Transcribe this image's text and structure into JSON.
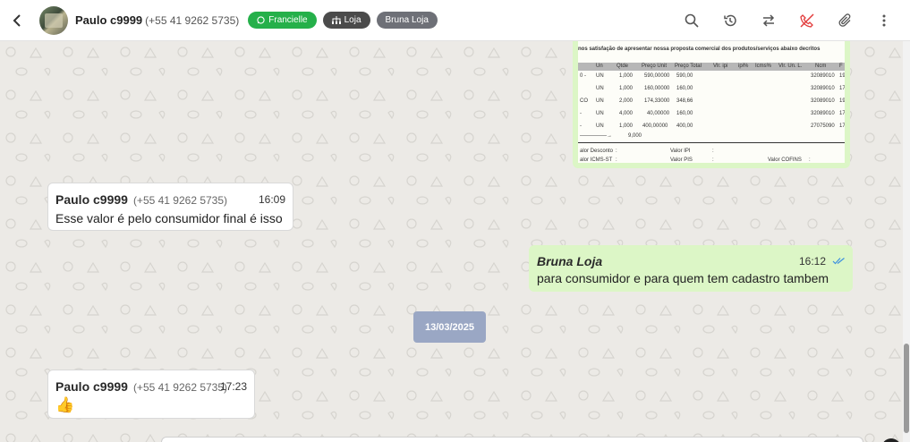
{
  "header": {
    "contact_name": "Paulo c9999",
    "contact_phone": "(+55 41 9262 5735)",
    "tags": [
      {
        "label": "Francielle",
        "color": "#25b04a",
        "icon": "whatsapp-icon"
      },
      {
        "label": "Loja",
        "color": "#4b4b4b",
        "icon": "sitemap-icon"
      },
      {
        "label": "Bruna Loja",
        "color": "#6e7077",
        "icon": ""
      }
    ],
    "actions": [
      "search-icon",
      "history-icon",
      "transfer-icon",
      "end-call-icon",
      "attach-icon",
      "more-icon"
    ]
  },
  "document": {
    "intro": "nos satisfação de apresentar nossa proposta comercial dos produtos/serviços abaixo decritos",
    "columns": [
      "Un",
      "Qtde",
      "Preço Unit",
      "Preço Total",
      "Vlr. ipi",
      "ipi%",
      "Icms%",
      "Vlr. Un. L.",
      "Ncm",
      "F"
    ],
    "rows": [
      {
        "prefix": "0 -",
        "un": "UN",
        "qtde": "1,000",
        "unit": "590,00000",
        "total": "590,00",
        "ncm": "32089010",
        "f": "19"
      },
      {
        "prefix": "",
        "un": "UN",
        "qtde": "1,000",
        "unit": "160,00000",
        "total": "160,00",
        "ncm": "32089010",
        "f": "17"
      },
      {
        "prefix": "CO",
        "un": "UN",
        "qtde": "2,000",
        "unit": "174,33000",
        "total": "348,66",
        "ncm": "32089010",
        "f": "19"
      },
      {
        "prefix": "-",
        "un": "UN",
        "qtde": "4,000",
        "unit": "40,00000",
        "total": "160,00",
        "ncm": "32089010",
        "f": "17"
      },
      {
        "prefix": "-",
        "un": "UN",
        "qtde": "1,000",
        "unit": "400,00000",
        "total": "400,00",
        "ncm": "27075090",
        "f": "17"
      }
    ],
    "total_qty": "9,000",
    "footer": [
      {
        "label": "alor Desconto",
        "sep": ":",
        "label2": "Valor IPI",
        "sep2": ":"
      },
      {
        "label": "alor ICMS-ST",
        "sep": ":",
        "label2": "Valor PIS",
        "sep2": ":",
        "label3": "Valor COFINS",
        "sep3": ":"
      }
    ]
  },
  "messages": [
    {
      "sender": "Paulo c9999",
      "phone": "(+55 41 9262 5735)",
      "time": "16:09",
      "text": "Esse valor é pelo consumidor final é isso"
    },
    {
      "sender": "Bruna Loja",
      "time": "16:12",
      "text": "para consumidor e para quem tem cadastro tambem",
      "status": "read"
    },
    {
      "sender": "Paulo c9999",
      "phone": "(+55 41 9262 5735)",
      "time": "17:23",
      "text": "👍"
    }
  ],
  "date_separator": "13/03/2025"
}
